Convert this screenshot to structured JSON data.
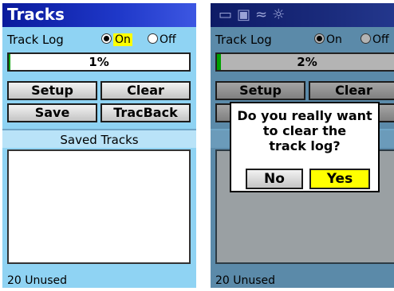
{
  "left": {
    "title": "Tracks",
    "track_log_label": "Track Log",
    "on_label": "On",
    "off_label": "Off",
    "selected": "On",
    "progress_text": "1%",
    "progress_percent": 1,
    "buttons": {
      "setup": "Setup",
      "clear": "Clear",
      "save": "Save",
      "tracback": "TracBack"
    },
    "saved_tracks_header": "Saved Tracks",
    "unused": "20 Unused"
  },
  "right": {
    "status_icons": "satellite-icon, 2d-icon, track-icon, light-icon",
    "track_log_label": "Track Log",
    "on_label": "On",
    "off_label": "Off",
    "selected": "On",
    "progress_text": "2%",
    "progress_percent": 2,
    "buttons": {
      "setup": "Setup",
      "clear": "Clear"
    },
    "dialog": {
      "message": "Do you really want\nto clear the\ntrack log?",
      "no": "No",
      "yes": "Yes"
    },
    "unused": "20 Unused"
  },
  "colors": {
    "screen_bg": "#8fd3f3",
    "title_bar": "#1f38c9",
    "highlight": "#ffff00",
    "progress_fill": "#00a000"
  }
}
